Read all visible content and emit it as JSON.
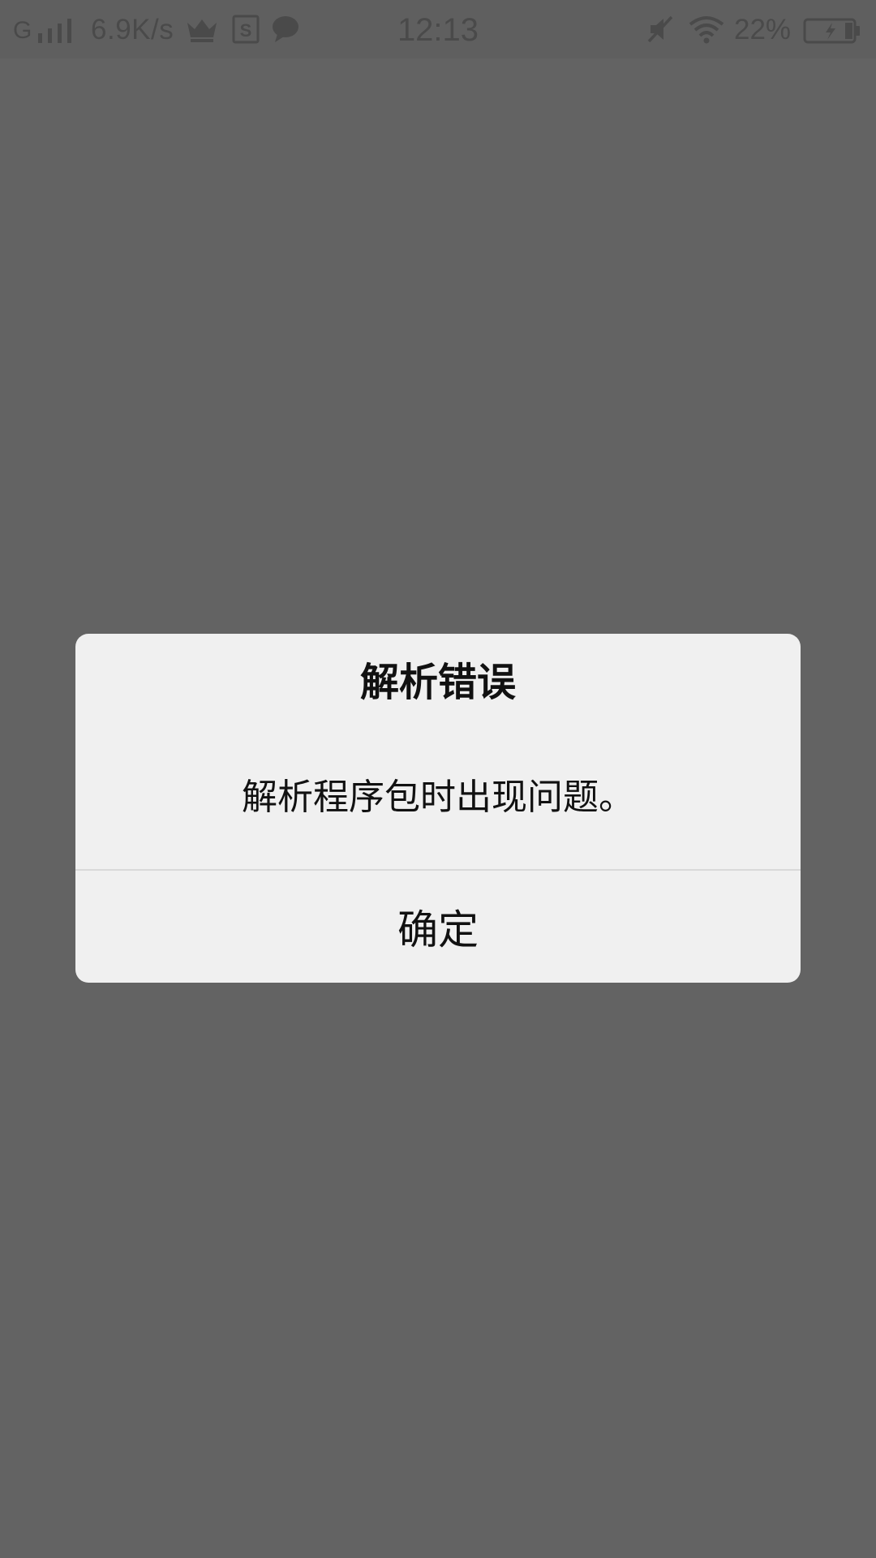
{
  "status_bar": {
    "network_type": "G",
    "net_speed": "6.9K/s",
    "time": "12:13",
    "battery_percent": "22%",
    "icons": {
      "signal": "signal-bars-icon",
      "crown": "crown-icon",
      "app_s": "s-app-icon",
      "chat": "chat-bubble-icon",
      "mute": "mute-icon",
      "wifi": "wifi-icon",
      "battery": "battery-charging-icon"
    }
  },
  "dialog": {
    "title": "解析错误",
    "message": "解析程序包时出现问题。",
    "confirm_label": "确定"
  },
  "colors": {
    "scrim": "#636363",
    "dialog_bg": "#f0f0f0",
    "text": "#111111",
    "status_icons": "#4a4a4a"
  }
}
